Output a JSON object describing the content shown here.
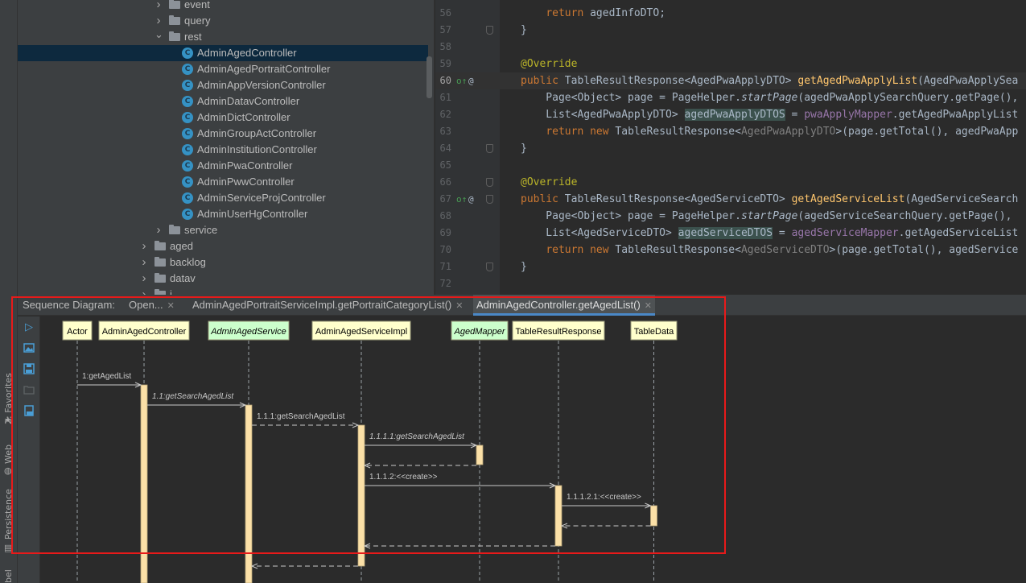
{
  "side_strip": {
    "tabs": [
      "2: Favorites",
      "Web",
      "Persistence"
    ],
    "bottom_label": "bel"
  },
  "project_tree": {
    "rows": [
      {
        "label": "event",
        "kind": "folder",
        "expanded": false,
        "depth": 3
      },
      {
        "label": "query",
        "kind": "folder",
        "expanded": false,
        "depth": 3
      },
      {
        "label": "rest",
        "kind": "folder",
        "expanded": true,
        "depth": 3
      },
      {
        "label": "AdminAgedController",
        "kind": "class",
        "depth": 4,
        "selected": true
      },
      {
        "label": "AdminAgedPortraitController",
        "kind": "class",
        "depth": 4
      },
      {
        "label": "AdminAppVersionController",
        "kind": "class",
        "depth": 4
      },
      {
        "label": "AdminDatavController",
        "kind": "class",
        "depth": 4
      },
      {
        "label": "AdminDictController",
        "kind": "class",
        "depth": 4
      },
      {
        "label": "AdminGroupActController",
        "kind": "class",
        "depth": 4
      },
      {
        "label": "AdminInstitutionController",
        "kind": "class",
        "depth": 4
      },
      {
        "label": "AdminPwaController",
        "kind": "class",
        "depth": 4
      },
      {
        "label": "AdminPwwController",
        "kind": "class",
        "depth": 4
      },
      {
        "label": "AdminServiceProjController",
        "kind": "class",
        "depth": 4
      },
      {
        "label": "AdminUserHgController",
        "kind": "class",
        "depth": 4
      },
      {
        "label": "service",
        "kind": "folder",
        "expanded": false,
        "depth": 3
      },
      {
        "label": "aged",
        "kind": "folder",
        "expanded": false,
        "depth": 2
      },
      {
        "label": "backlog",
        "kind": "folder",
        "expanded": false,
        "depth": 2
      },
      {
        "label": "datav",
        "kind": "folder",
        "expanded": false,
        "depth": 2
      },
      {
        "label": "i...",
        "kind": "folder",
        "expanded": false,
        "depth": 2
      }
    ]
  },
  "editor": {
    "lines": [
      {
        "n": "56",
        "text": "        return agedInfoDTO;"
      },
      {
        "n": "57",
        "text": "    }"
      },
      {
        "n": "58",
        "text": ""
      },
      {
        "n": "59",
        "text": "    @Override"
      },
      {
        "n": "60",
        "text": "    public TableResultResponse<AgedPwaApplyDTO> getAgedPwaApplyList(AgedPwaApplySea"
      },
      {
        "n": "61",
        "text": "        Page<Object> page = PageHelper.startPage(agedPwaApplySearchQuery.getPage(),"
      },
      {
        "n": "62",
        "text": "        List<AgedPwaApplyDTO> agedPwaApplyDTOS = pwaApplyMapper.getAgedPwaApplyList"
      },
      {
        "n": "63",
        "text": "        return new TableResultResponse<AgedPwaApplyDTO>(page.getTotal(), agedPwaApp"
      },
      {
        "n": "64",
        "text": "    }"
      },
      {
        "n": "65",
        "text": ""
      },
      {
        "n": "66",
        "text": "    @Override"
      },
      {
        "n": "67",
        "text": "    public TableResultResponse<AgedServiceDTO> getAgedServiceList(AgedServiceSearch"
      },
      {
        "n": "68",
        "text": "        Page<Object> page = PageHelper.startPage(agedServiceSearchQuery.getPage(),"
      },
      {
        "n": "69",
        "text": "        List<AgedServiceDTO> agedServiceDTOS = agedServiceMapper.getAgedServiceList"
      },
      {
        "n": "70",
        "text": "        return new TableResultResponse<AgedServiceDTO>(page.getTotal(), agedService"
      },
      {
        "n": "71",
        "text": "    }"
      },
      {
        "n": "72",
        "text": ""
      }
    ]
  },
  "panel": {
    "title": "Sequence Diagram:",
    "tabs": [
      {
        "label": "Open...",
        "active": false
      },
      {
        "label": "AdminAgedPortraitServiceImpl.getPortraitCategoryList()",
        "active": false
      },
      {
        "label": "AdminAgedController.getAgedList()",
        "active": true
      }
    ],
    "close_glyph": "✕",
    "toolbar_icons": [
      "run-icon",
      "image-icon",
      "save-icon",
      "open-folder-icon",
      "export-icon"
    ]
  },
  "sequence_diagram": {
    "participants": [
      {
        "name": "Actor",
        "style": "class"
      },
      {
        "name": "AdminAgedController",
        "style": "class"
      },
      {
        "name": "AdminAgedService",
        "style": "interface"
      },
      {
        "name": "AdminAgedServiceImpl",
        "style": "class"
      },
      {
        "name": "AgedMapper",
        "style": "interface"
      },
      {
        "name": "TableResultResponse",
        "style": "class"
      },
      {
        "name": "TableData",
        "style": "class"
      }
    ],
    "messages": [
      {
        "label": "1:getAgedList",
        "from": 0,
        "to": 1,
        "kind": "call",
        "italic": false
      },
      {
        "label": "1.1:getSearchAgedList",
        "from": 1,
        "to": 2,
        "kind": "call",
        "italic": true
      },
      {
        "label": "1.1.1:getSearchAgedList",
        "from": 2,
        "to": 3,
        "kind": "dashed-call",
        "italic": false
      },
      {
        "label": "1.1.1.1:getSearchAgedList",
        "from": 3,
        "to": 4,
        "kind": "call",
        "italic": true
      },
      {
        "label": "",
        "from": 4,
        "to": 3,
        "kind": "return",
        "italic": false
      },
      {
        "label": "1.1.1.2:<<create>>",
        "from": 3,
        "to": 5,
        "kind": "call",
        "italic": false
      },
      {
        "label": "1.1.1.2.1:<<create>>",
        "from": 5,
        "to": 6,
        "kind": "call",
        "italic": false
      },
      {
        "label": "",
        "from": 6,
        "to": 5,
        "kind": "return",
        "italic": false
      },
      {
        "label": "",
        "from": 5,
        "to": 3,
        "kind": "return",
        "italic": false
      },
      {
        "label": "",
        "from": 3,
        "to": 2,
        "kind": "return",
        "italic": false
      }
    ]
  },
  "colors": {
    "class_box": "#ffffcc",
    "interface_box": "#ccffcc",
    "activation": "#fbe0a7",
    "lifeline": "#9aa0a6",
    "arrow": "#c8c8c8",
    "highlight_border": "#e81a1a"
  }
}
